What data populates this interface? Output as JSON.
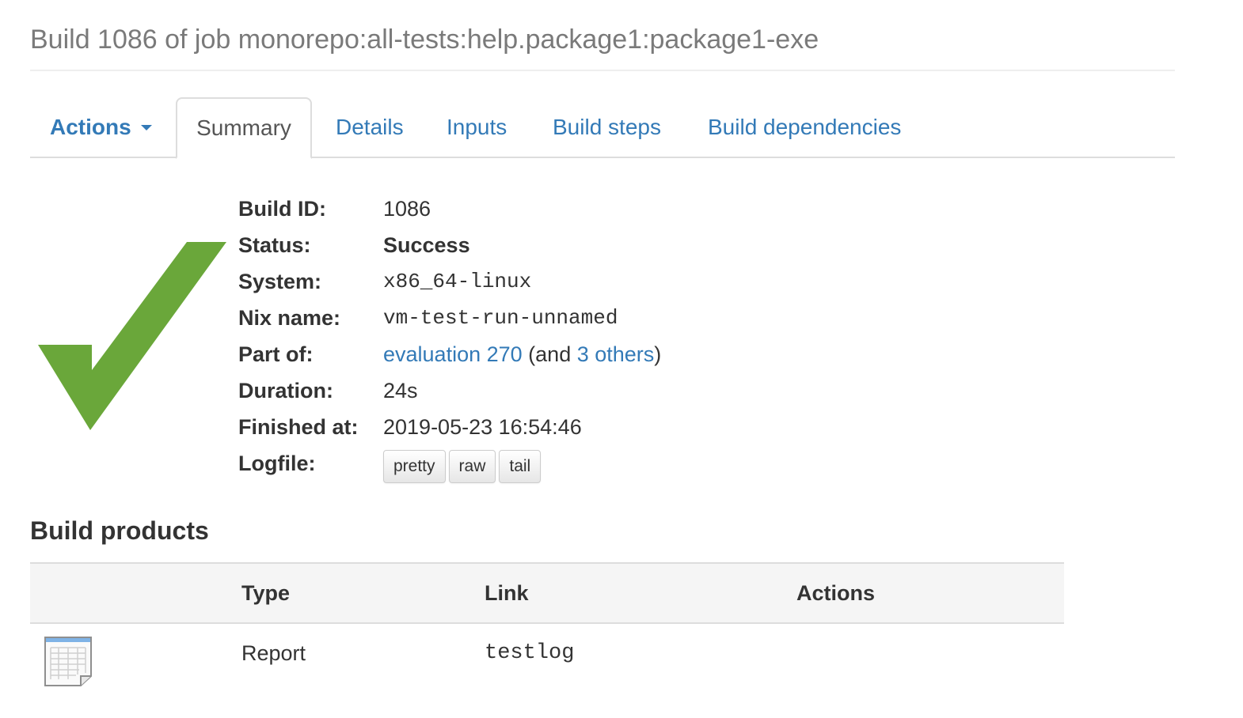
{
  "title": "Build 1086 of job monorepo:all-tests:help.package1:package1-exe",
  "tabs": {
    "actions": "Actions",
    "summary": "Summary",
    "details": "Details",
    "inputs": "Inputs",
    "build_steps": "Build steps",
    "build_dependencies": "Build dependencies"
  },
  "status_icon": "checkmark-icon",
  "colors": {
    "link": "#337ab7",
    "success": "#6aa73a"
  },
  "info": {
    "build_id": {
      "label": "Build ID:",
      "value": "1086"
    },
    "status": {
      "label": "Status:",
      "value": "Success"
    },
    "system": {
      "label": "System:",
      "value": "x86_64-linux"
    },
    "nix_name": {
      "label": "Nix name:",
      "value": "vm-test-run-unnamed"
    },
    "part_of": {
      "label": "Part of:",
      "evaluation_link": "evaluation 270",
      "and_text": "(and",
      "others_link": "3 others",
      "close_paren": ")"
    },
    "duration": {
      "label": "Duration:",
      "value": "24s"
    },
    "finished_at": {
      "label": "Finished at:",
      "value": "2019-05-23 16:54:46"
    },
    "logfile": {
      "label": "Logfile:",
      "buttons": [
        "pretty",
        "raw",
        "tail"
      ]
    }
  },
  "build_products": {
    "heading": "Build products",
    "columns": [
      "",
      "Type",
      "Link",
      "Actions"
    ],
    "rows": [
      {
        "icon": "report-icon",
        "type": "Report",
        "link": "testlog",
        "actions": ""
      }
    ]
  }
}
